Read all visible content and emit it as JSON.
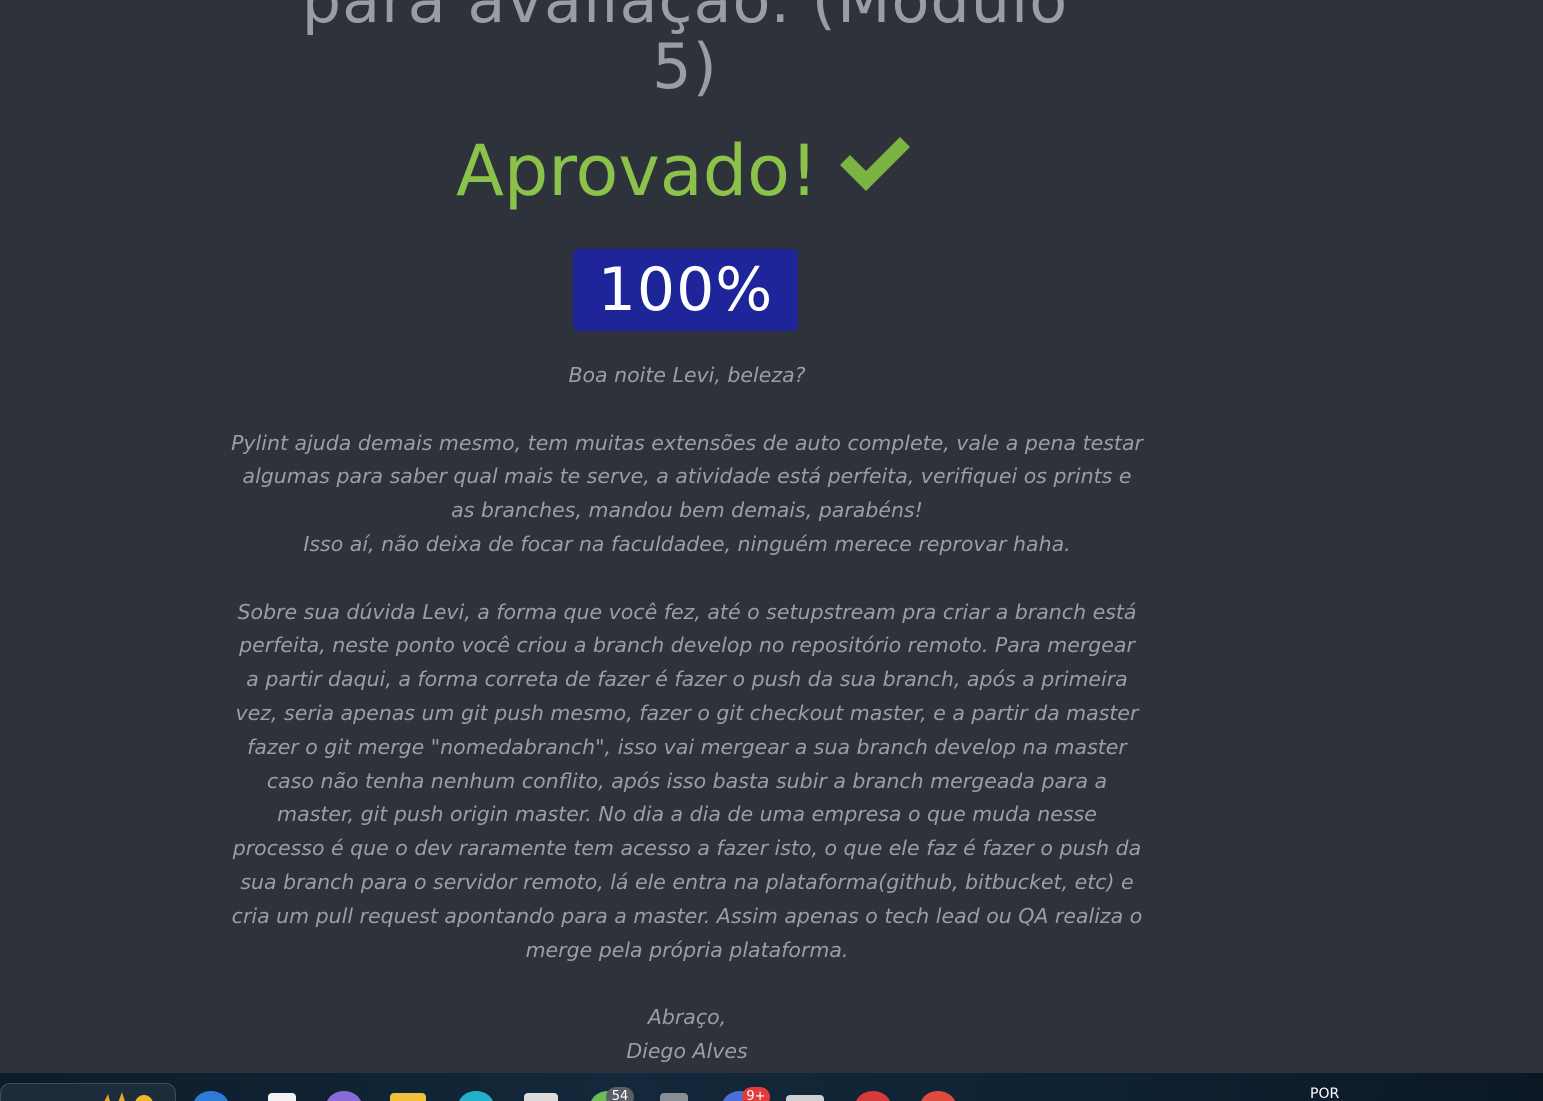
{
  "page": {
    "title_lines": [
      "para avaliação. (Módulo",
      "5)"
    ],
    "status_text": "Aprovado!",
    "score": "100%",
    "feedback": {
      "greeting": "Boa noite Levi, beleza?",
      "paragraph_1": "Pylint ajuda demais mesmo, tem muitas extensões de auto complete, vale a pena testar algumas para saber qual mais te serve, a atividade está perfeita, verifiquei os prints e as branches, mandou bem demais, parabéns!",
      "paragraph_1b": "Isso aí, não deixa de focar na faculdadee, ninguém merece reprovar haha.",
      "paragraph_2": "Sobre sua dúvida Levi, a forma que você fez, até o setupstream pra criar a branch está perfeita, neste ponto você criou a branch develop no repositório remoto. Para mergear a partir daqui, a forma correta de fazer é fazer o push da sua branch, após a primeira vez, seria apenas um git push mesmo, fazer o git checkout master, e a partir da master fazer o git merge \"nomedabranch\", isso vai mergear a sua branch develop na master caso não tenha nenhum conflito, após isso basta subir a branch mergeada para a master, git push origin master. No dia a dia de uma empresa o que muda nesse processo é que o dev raramente tem acesso a fazer isto, o que ele faz é fazer o push da sua branch para o servidor remoto, lá ele entra na plataforma(github, bitbucket, etc) e cria um pull request apontando para a master. Assim apenas o tech lead ou QA realiza o merge pela própria plataforma.",
      "closing": "Abraço,",
      "signature": "Diego Alves"
    }
  },
  "taskbar": {
    "badge_chat": "54",
    "badge_notifications": "9+",
    "language": "POR"
  },
  "colors": {
    "background": "#2e323b",
    "title": "#9a9da3",
    "approved": "#8bc34a",
    "check": "#7cb342",
    "score_bg": "#1d2599",
    "body_text": "#9c9ea4"
  },
  "icons": {
    "status": "checkmark-icon"
  }
}
